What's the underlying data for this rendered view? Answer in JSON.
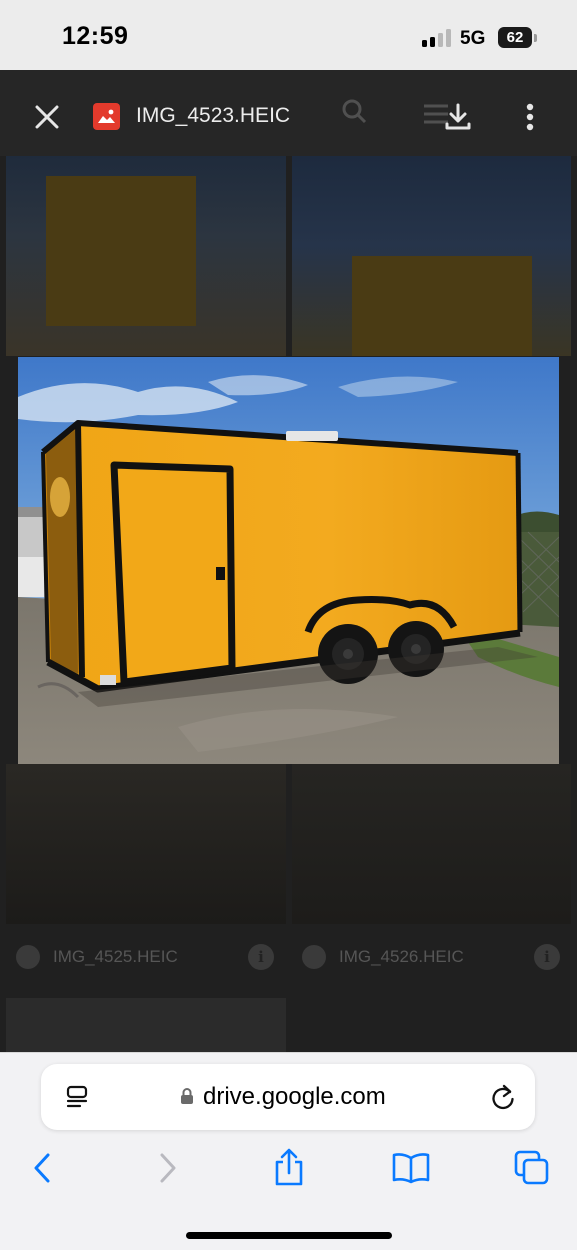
{
  "status_bar": {
    "time": "12:59",
    "network": "5G",
    "battery": "62"
  },
  "viewer": {
    "file_name": "IMG_4523.HEIC",
    "close_icon": "close-icon",
    "file_type_icon": "image-file-icon",
    "download_icon": "download-icon",
    "more_icon": "more-vert-icon",
    "background_files": [
      {
        "name": "IMG_4525.HEIC"
      },
      {
        "name": "IMG_4526.HEIC"
      }
    ]
  },
  "photo": {
    "subject": "yellow-enclosed-trailer-photo"
  },
  "safari": {
    "url": "drive.google.com",
    "reader_icon": "reader-mode-icon",
    "lock_icon": "lock-icon",
    "reload_icon": "reload-icon",
    "toolbar": {
      "back_icon": "back-chevron-icon",
      "forward_icon": "forward-chevron-icon",
      "share_icon": "share-icon",
      "bookmarks_icon": "bookmarks-icon",
      "tabs_icon": "tabs-icon"
    }
  },
  "colors": {
    "trailer_yellow": "#f1a81a",
    "accent_blue": "#0a7aff",
    "viewer_dark": "#202020",
    "file_icon_red": "#e33a2c"
  }
}
